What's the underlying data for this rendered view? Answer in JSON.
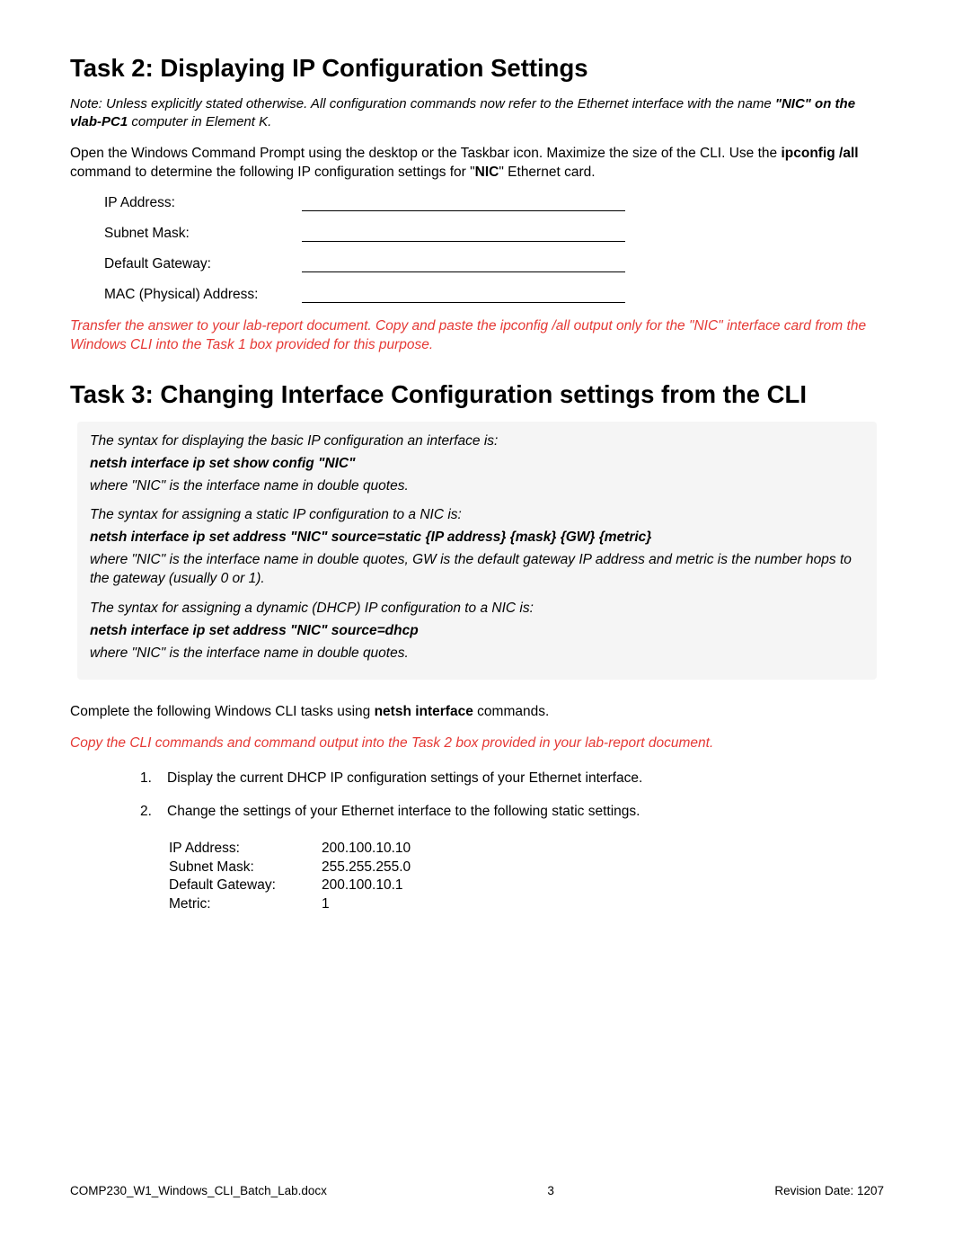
{
  "task2": {
    "title": "Task 2: Displaying IP Configuration Settings",
    "note_prefix": "Note: Unless explicitly stated otherwise. All configuration commands now refer to the Ethernet interface with the name ",
    "note_bold": "\"NIC\" on the vlab-PC1",
    "note_suffix": " computer in Element K.",
    "open_p1": "Open the Windows Command Prompt using the desktop or the Taskbar icon. Maximize the size of the CLI. Use the ",
    "open_bold1": "ipconfig /all",
    "open_p2": " command to determine the following IP configuration settings for \"",
    "open_bold2": "NIC",
    "open_p3": "\" Ethernet card.",
    "fields": {
      "ip": "IP Address:",
      "mask": "Subnet Mask:",
      "gw": "Default Gateway:",
      "mac": "MAC (Physical) Address:"
    },
    "red_p1": "Transfer the answer to your lab-report document. Copy and paste the ipconfig /all output only for the \"NIC\" interface card from the Windows CLI into the Task 1 box provided for this purpose."
  },
  "task3": {
    "title": "Task 3: Changing Interface Configuration settings from the CLI",
    "box": {
      "l1": "The syntax for displaying the basic IP configuration an interface is:",
      "l2": "netsh interface ip set show config \"NIC\"",
      "l3": "where \"NIC\" is the interface name in double quotes.",
      "l4": "The syntax for assigning a static IP configuration to a NIC is:",
      "l5": "netsh interface ip set address \"NIC\" source=static {IP address} {mask} {GW} {metric}",
      "l6": "where \"NIC\" is the interface name in double quotes, GW is the default gateway IP address and metric is the number hops to the gateway (usually 0 or 1).",
      "l7": "The syntax for assigning a dynamic (DHCP) IP configuration to a NIC is:",
      "l8": "netsh interface ip set address \"NIC\" source=dhcp",
      "l9": "where \"NIC\" is the interface name in double quotes."
    },
    "complete_p1": "Complete the following Windows CLI tasks using ",
    "complete_bold": "netsh interface",
    "complete_p2": " commands.",
    "red_p": "Copy the CLI commands and command output into the Task 2 box provided in your lab-report document.",
    "items": {
      "n1": "1.",
      "t1": "Display the current DHCP IP configuration settings of your Ethernet interface.",
      "n2": "2.",
      "t2": "Change the settings of your Ethernet interface to the following static settings."
    },
    "settings": {
      "ip_l": "IP Address:",
      "ip_v": "200.100.10.10",
      "mask_l": "Subnet Mask:",
      "mask_v": "255.255.255.0",
      "gw_l": "Default Gateway:",
      "gw_v": "200.100.10.1",
      "metric_l": "Metric:",
      "metric_v": "1"
    }
  },
  "footer": {
    "left": "COMP230_W1_Windows_CLI_Batch_Lab.docx",
    "center": "3",
    "right": "Revision Date: 1207"
  }
}
